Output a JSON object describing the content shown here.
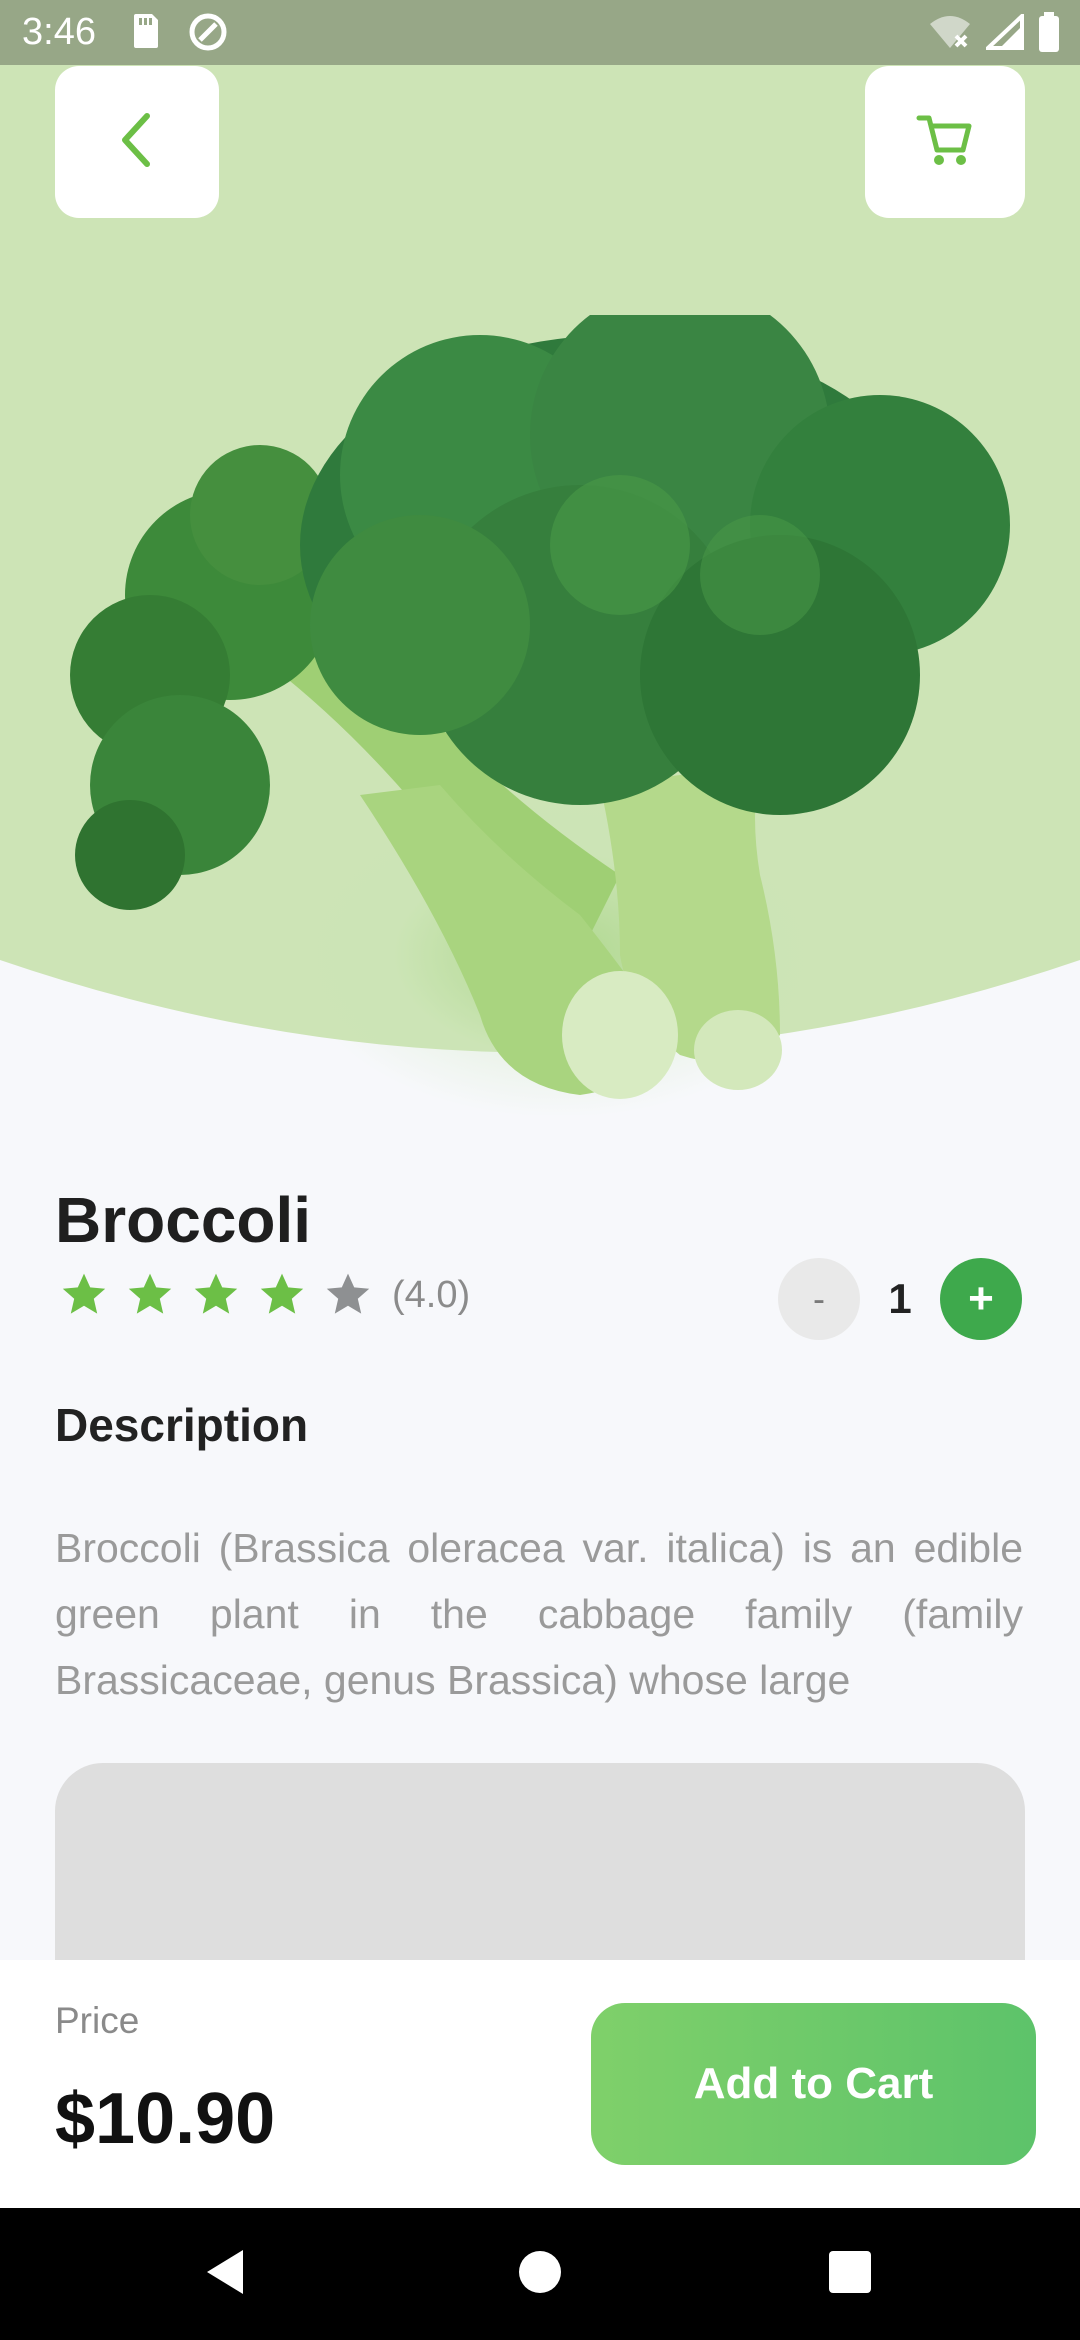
{
  "status_bar": {
    "time": "3:46"
  },
  "product": {
    "name": "Broccoli",
    "rating_value": 4.0,
    "rating_text": "(4.0)",
    "stars_filled": 4,
    "stars_total": 5,
    "quantity": "1",
    "minus_label": "-",
    "plus_label": "+"
  },
  "description": {
    "heading": "Description",
    "text": "Broccoli (Brassica oleracea var. italica) is an edible green plant in the cabbage family (family Brassicaceae, genus Brassica) whose large"
  },
  "footer": {
    "price_label": "Price",
    "price_value": "$10.90",
    "add_button_label": "Add to Cart"
  },
  "colors": {
    "accent_green": "#3ea94c",
    "light_green_bg": "#cde4b6",
    "star_filled": "#6cbf46",
    "star_empty": "#8e9092"
  },
  "icons": {
    "back": "chevron-left-icon",
    "cart": "shopping-cart-icon",
    "nav_back": "nav-back-icon",
    "nav_home": "nav-home-icon",
    "nav_recents": "nav-recents-icon"
  }
}
